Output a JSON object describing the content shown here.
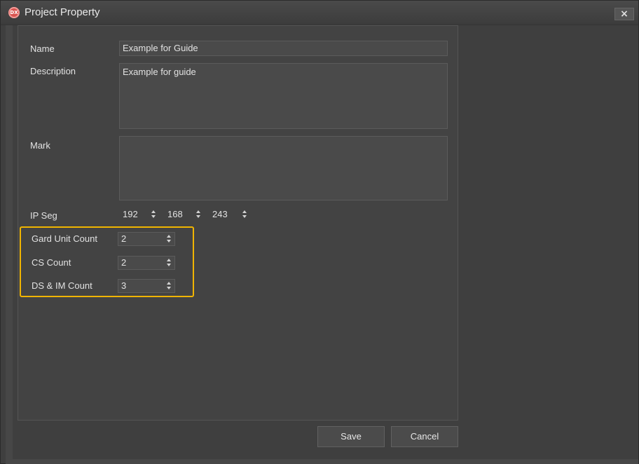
{
  "window": {
    "title": "Project Property",
    "icon_text": "DX",
    "close_label": "×"
  },
  "form": {
    "name_label": "Name",
    "name_value": "Example for Guide",
    "description_label": "Description",
    "description_value": "Example for guide",
    "mark_label": "Mark",
    "mark_value": "",
    "ip_seg_label": "IP Seg",
    "ip_seg": [
      "192",
      "168",
      "243"
    ],
    "gard_unit_label": "Gard Unit Count",
    "gard_unit_value": "2",
    "cs_count_label": "CS Count",
    "cs_count_value": "2",
    "ds_im_label": "DS & IM Count",
    "ds_im_value": "3"
  },
  "buttons": {
    "save": "Save",
    "cancel": "Cancel"
  },
  "colors": {
    "highlight": "#f0b400",
    "background": "#3f3f3f",
    "app_icon": "#d9534f"
  }
}
